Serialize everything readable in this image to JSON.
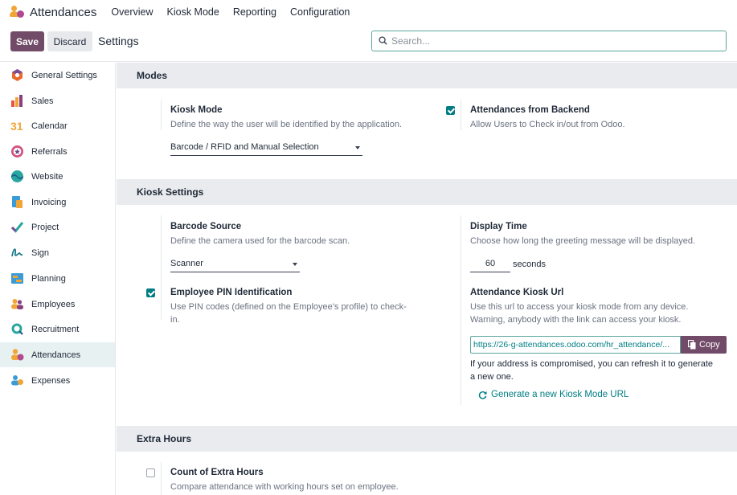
{
  "topnav": {
    "app_title": "Attendances",
    "menu": [
      "Overview",
      "Kiosk Mode",
      "Reporting",
      "Configuration"
    ]
  },
  "control": {
    "save_label": "Save",
    "discard_label": "Discard",
    "breadcrumb": "Settings",
    "search_placeholder": "Search..."
  },
  "sidebar": {
    "items": [
      {
        "label": "General Settings",
        "icon": "general-settings-icon"
      },
      {
        "label": "Sales",
        "icon": "sales-icon"
      },
      {
        "label": "Calendar",
        "icon": "calendar-icon"
      },
      {
        "label": "Referrals",
        "icon": "referrals-icon"
      },
      {
        "label": "Website",
        "icon": "website-icon"
      },
      {
        "label": "Invoicing",
        "icon": "invoicing-icon"
      },
      {
        "label": "Project",
        "icon": "project-icon"
      },
      {
        "label": "Sign",
        "icon": "sign-icon"
      },
      {
        "label": "Planning",
        "icon": "planning-icon"
      },
      {
        "label": "Employees",
        "icon": "employees-icon"
      },
      {
        "label": "Recruitment",
        "icon": "recruitment-icon"
      },
      {
        "label": "Attendances",
        "icon": "attendances-icon"
      },
      {
        "label": "Expenses",
        "icon": "expenses-icon"
      }
    ],
    "active": "Attendances"
  },
  "calendar_icon_text": "31",
  "sections": {
    "modes": {
      "title": "Modes",
      "kiosk_mode": {
        "title": "Kiosk Mode",
        "desc": "Define the way the user will be identified by the application.",
        "value": "Barcode / RFID and Manual Selection"
      },
      "backend": {
        "title": "Attendances from Backend",
        "desc": "Allow Users to Check in/out from Odoo.",
        "checked": true
      }
    },
    "kiosk": {
      "title": "Kiosk Settings",
      "barcode_source": {
        "title": "Barcode Source",
        "desc": "Define the camera used for the barcode scan.",
        "value": "Scanner"
      },
      "display_time": {
        "title": "Display Time",
        "desc": "Choose how long the greeting message will be displayed.",
        "value": "60",
        "unit": "seconds"
      },
      "pin": {
        "title": "Employee PIN Identification",
        "desc_line1": "Use PIN codes (defined on the Employee's profile) to check-",
        "desc_line2": "in.",
        "checked": true
      },
      "kiosk_url": {
        "title": "Attendance Kiosk Url",
        "desc_line1": "Use this url to access your kiosk mode from any device.",
        "desc_line2": "Warning, anybody with the link can access your kiosk.",
        "url": "https://26-g-attendances.odoo.com/hr_attendance/...",
        "copy_label": "Copy",
        "compromised_line1": "If your address is compromised, you can refresh it to generate",
        "compromised_line2": "a new one.",
        "generate_label": "Generate a new Kiosk Mode URL"
      }
    },
    "extra": {
      "title": "Extra Hours",
      "count": {
        "title": "Count of Extra Hours",
        "desc": "Compare attendance with working hours set on employee.",
        "checked": false
      }
    }
  },
  "colors": {
    "brand": "#714b67",
    "accent": "#017e84",
    "section_bg": "#e9ebee"
  }
}
